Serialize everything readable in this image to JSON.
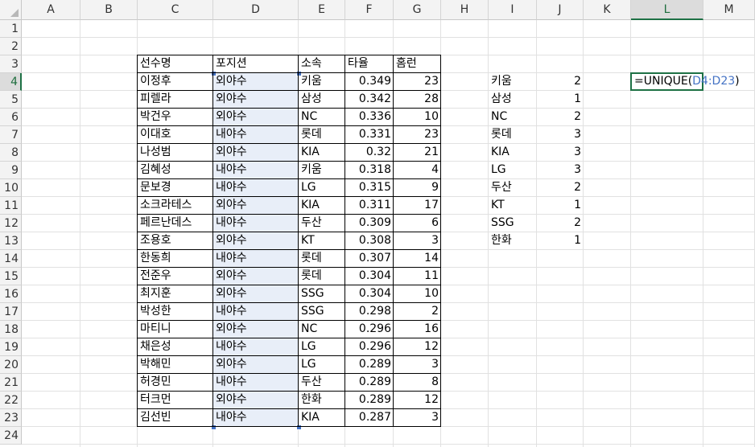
{
  "columns": [
    "A",
    "B",
    "C",
    "D",
    "E",
    "F",
    "G",
    "H",
    "I",
    "J",
    "K",
    "L",
    "M"
  ],
  "rows": [
    "1",
    "2",
    "3",
    "4",
    "5",
    "6",
    "7",
    "8",
    "9",
    "10",
    "11",
    "12",
    "13",
    "14",
    "15",
    "16",
    "17",
    "18",
    "19",
    "20",
    "21",
    "22",
    "23",
    "24"
  ],
  "active_column": "L",
  "active_row": "4",
  "table": {
    "headers": [
      "선수명",
      "포지션",
      "소속",
      "타율",
      "홈런"
    ],
    "rows": [
      [
        "이정후",
        "외야수",
        "키움",
        "0.349",
        "23"
      ],
      [
        "피렐라",
        "외야수",
        "삼성",
        "0.342",
        "28"
      ],
      [
        "박건우",
        "외야수",
        "NC",
        "0.336",
        "10"
      ],
      [
        "이대호",
        "내야수",
        "롯데",
        "0.331",
        "23"
      ],
      [
        "나성범",
        "외야수",
        "KIA",
        "0.32",
        "21"
      ],
      [
        "김혜성",
        "내야수",
        "키움",
        "0.318",
        "4"
      ],
      [
        "문보경",
        "내야수",
        "LG",
        "0.315",
        "9"
      ],
      [
        "소크라테스",
        "외야수",
        "KIA",
        "0.311",
        "17"
      ],
      [
        "페르난데스",
        "내야수",
        "두산",
        "0.309",
        "6"
      ],
      [
        "조용호",
        "외야수",
        "KT",
        "0.308",
        "3"
      ],
      [
        "한동희",
        "내야수",
        "롯데",
        "0.307",
        "14"
      ],
      [
        "전준우",
        "외야수",
        "롯데",
        "0.304",
        "11"
      ],
      [
        "최지훈",
        "외야수",
        "SSG",
        "0.304",
        "10"
      ],
      [
        "박성한",
        "내야수",
        "SSG",
        "0.298",
        "2"
      ],
      [
        "마티니",
        "외야수",
        "NC",
        "0.296",
        "16"
      ],
      [
        "채은성",
        "내야수",
        "LG",
        "0.296",
        "12"
      ],
      [
        "박해민",
        "외야수",
        "LG",
        "0.289",
        "3"
      ],
      [
        "허경민",
        "내야수",
        "두산",
        "0.289",
        "8"
      ],
      [
        "터크먼",
        "외야수",
        "한화",
        "0.289",
        "12"
      ],
      [
        "김선빈",
        "내야수",
        "KIA",
        "0.287",
        "3"
      ]
    ]
  },
  "summary": [
    [
      "키움",
      "2"
    ],
    [
      "삼성",
      "1"
    ],
    [
      "NC",
      "2"
    ],
    [
      "롯데",
      "3"
    ],
    [
      "KIA",
      "3"
    ],
    [
      "LG",
      "3"
    ],
    [
      "두산",
      "2"
    ],
    [
      "KT",
      "1"
    ],
    [
      "SSG",
      "2"
    ],
    [
      "한화",
      "1"
    ]
  ],
  "formula": {
    "prefix": "=UNIQUE(",
    "ref": "D4:D23",
    "suffix": ")"
  },
  "colors": {
    "selection_border": "#4472c4",
    "selection_fill": "#e8eef8",
    "active_cell": "#1e7145"
  }
}
